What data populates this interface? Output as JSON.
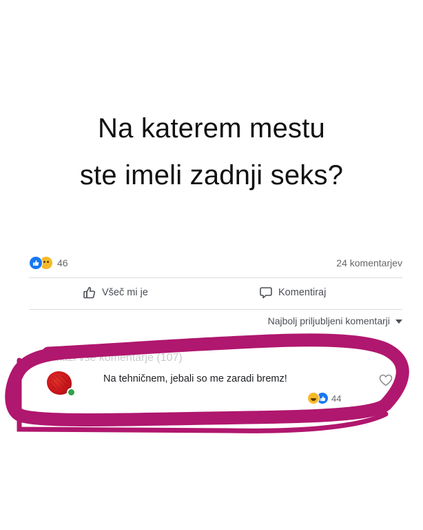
{
  "headline": {
    "line1": "Na katerem mestu",
    "line2": "ste imeli zadnji seks?"
  },
  "post": {
    "reaction_count": "46",
    "comment_count": "24 komentarjev",
    "actions": {
      "like_label": "Všeč mi je",
      "comment_label": "Komentiraj"
    },
    "sort_label": "Najbolj priljubljeni komentarji",
    "faded_text": "Prikaži vse komentarje (107)"
  },
  "comment": {
    "text": "Na tehničnem, jebali so me zaradi bremz!",
    "reaction_count": "44"
  },
  "icons": {
    "like": "thumbs-up-icon",
    "sad": "sad-emoji-icon",
    "comment": "speech-bubble-icon",
    "heart": "heart-outline-icon",
    "laugh": "laugh-emoji-icon"
  },
  "colors": {
    "accent_blue": "#1877f2",
    "annotation_magenta": "#b0176e",
    "online_green": "#31a24c"
  }
}
